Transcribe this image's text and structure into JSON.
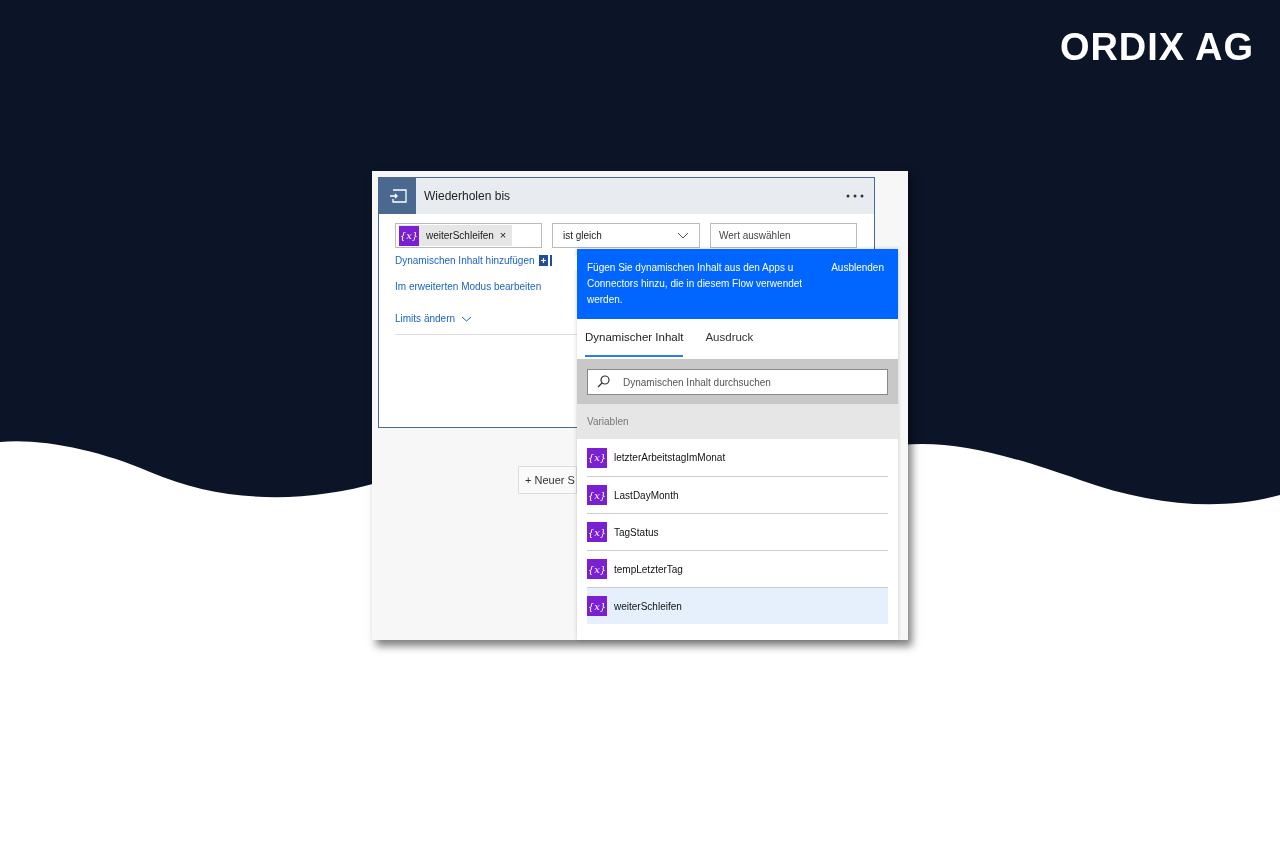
{
  "logo": "ORDIX AG",
  "card": {
    "title": "Wiederholen bis",
    "condition": {
      "token": {
        "icon": "{x}",
        "label": "weiterSchleifen",
        "remove": "×"
      },
      "operator": "ist gleich",
      "value_placeholder": "Wert auswählen"
    },
    "add_dynamic_link": "Dynamischen Inhalt hinzufügen",
    "advanced_link": "Im erweiterten Modus bearbeiten",
    "limits_link": "Limits ändern"
  },
  "new_step_button": "+ Neuer S",
  "panel": {
    "info_lines": [
      "Fügen Sie dynamischen Inhalt aus den Apps u",
      "Connectors hinzu, die in diesem Flow verwendet",
      "werden."
    ],
    "hide_link": "Ausblenden",
    "tabs": [
      {
        "label": "Dynamischer Inhalt",
        "selected": true
      },
      {
        "label": "Ausdruck",
        "selected": false
      }
    ],
    "search": {
      "placeholder": "Dynamischen Inhalt durchsuchen"
    },
    "section": "Variablen",
    "variables": [
      {
        "icon": "{x}",
        "name": "letzterArbeitstagImMonat",
        "selected": false
      },
      {
        "icon": "{x}",
        "name": "LastDayMonth",
        "selected": false
      },
      {
        "icon": "{x}",
        "name": "TagStatus",
        "selected": false
      },
      {
        "icon": "{x}",
        "name": "tempLetzterTag",
        "selected": false
      },
      {
        "icon": "{x}",
        "name": "weiterSchleifen",
        "selected": true
      }
    ]
  }
}
